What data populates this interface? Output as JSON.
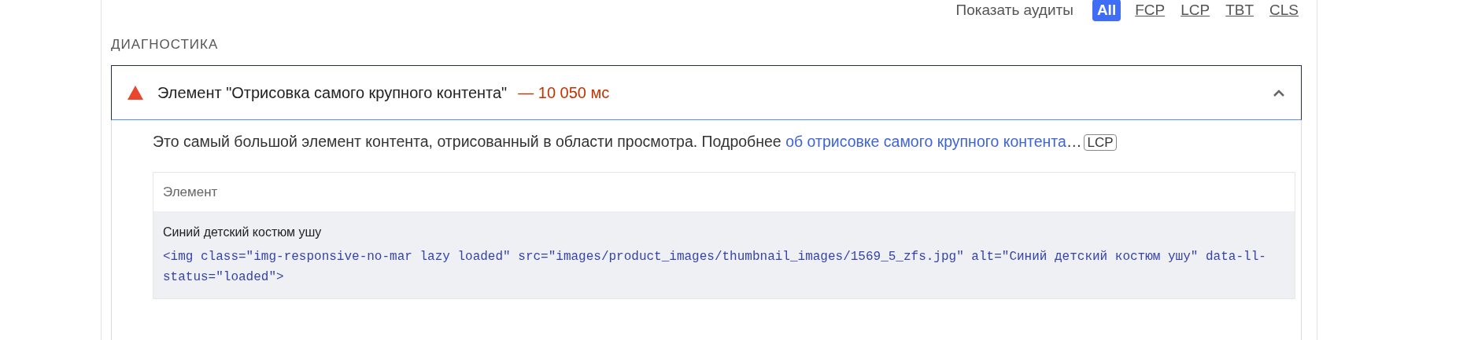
{
  "filter": {
    "label": "Показать аудиты",
    "options": [
      {
        "label": "All",
        "selected": true
      },
      {
        "label": "FCP",
        "selected": false
      },
      {
        "label": "LCP",
        "selected": false
      },
      {
        "label": "TBT",
        "selected": false
      },
      {
        "label": "CLS",
        "selected": false
      }
    ]
  },
  "section": {
    "title": "ДИАГНОСТИКА"
  },
  "audit": {
    "title": "Элемент \"Отрисовка самого крупного контента\"",
    "value": "— 10 050 мс",
    "expanded": true,
    "description": "Это самый большой элемент контента, отрисованный в области просмотра. Подробнее",
    "link": "об отрисовке самого крупного контента",
    "ellipsis": "…",
    "tag": "LCP",
    "table": {
      "columns": [
        "Элемент"
      ],
      "rows": [
        {
          "label": "Синий детский костюм ушу",
          "code": "<img class=\"img-responsive-no-mar lazy loaded\" src=\"images/product_images/thumbnail_images/1569_5_zfs.jpg\" alt=\"Синий детский костюм ушу\" data-ll-status=\"loaded\">"
        }
      ]
    }
  }
}
